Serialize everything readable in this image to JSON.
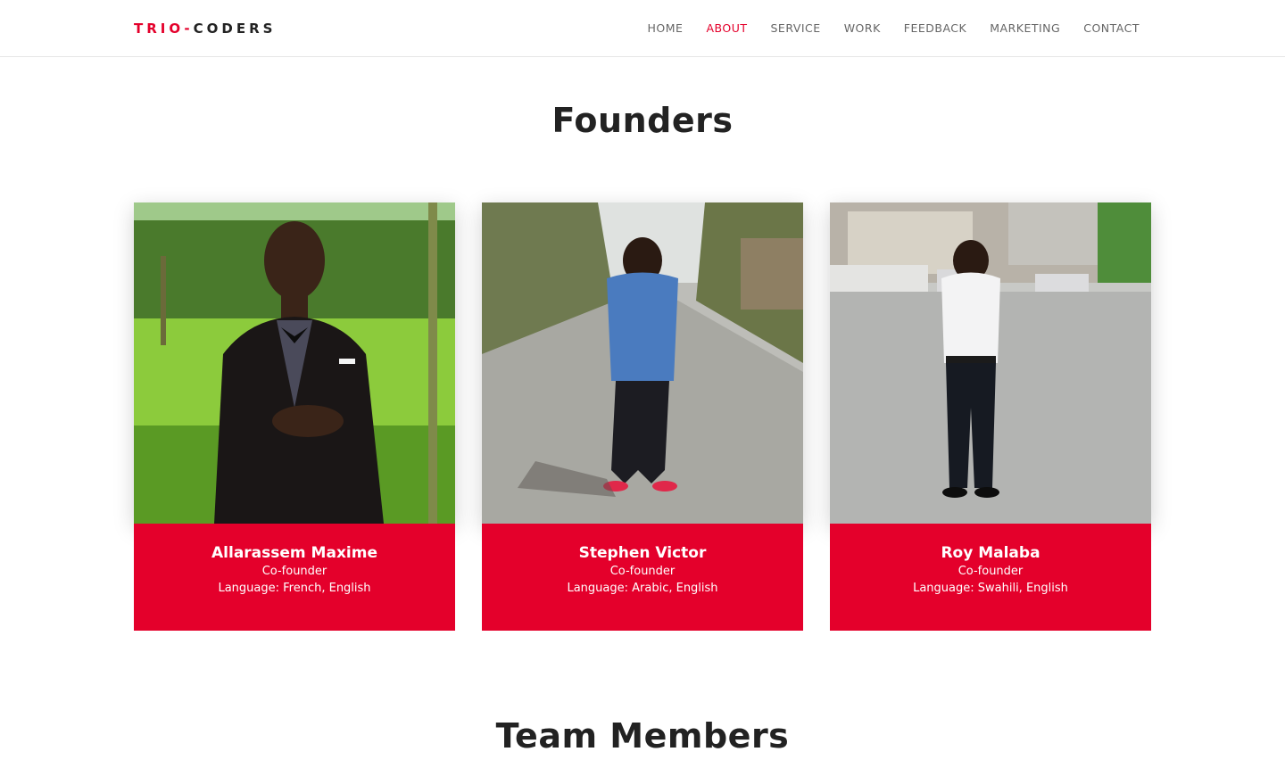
{
  "brand": {
    "part1": "TRIO-",
    "part2": "CODERS"
  },
  "nav": {
    "items": [
      {
        "label": "HOME"
      },
      {
        "label": "ABOUT"
      },
      {
        "label": "SERVICE"
      },
      {
        "label": "WORK"
      },
      {
        "label": "FEEDBACK"
      },
      {
        "label": "MARKETING"
      },
      {
        "label": "CONTACT"
      }
    ],
    "active": "ABOUT"
  },
  "founders": {
    "heading": "Founders",
    "cards": [
      {
        "name": "Allarassem Maxime",
        "role": "Co-founder",
        "language": "Language: French, English"
      },
      {
        "name": "Stephen Victor",
        "role": "Co-founder",
        "language": "Language: Arabic, English"
      },
      {
        "name": "Roy Malaba",
        "role": "Co-founder",
        "language": "Language: Swahili, English"
      }
    ]
  },
  "team": {
    "heading": "Team Members"
  },
  "colors": {
    "accent": "#e4002b",
    "text": "#222222",
    "nav": "#666666"
  }
}
